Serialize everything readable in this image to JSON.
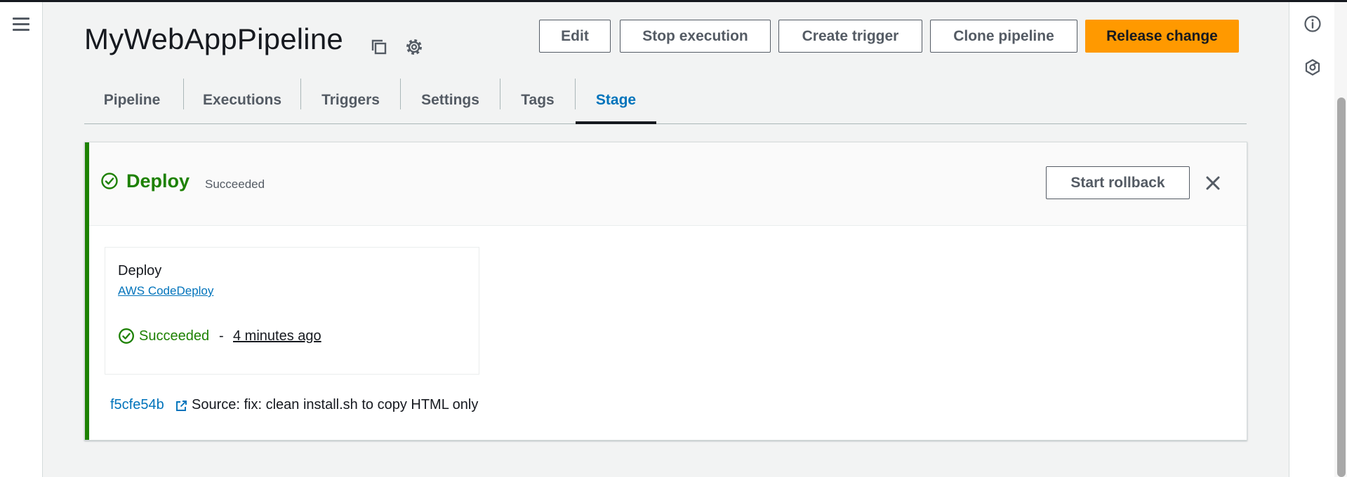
{
  "header": {
    "title": "MyWebAppPipeline",
    "buttons": {
      "edit": "Edit",
      "stop_execution": "Stop execution",
      "create_trigger": "Create trigger",
      "clone_pipeline": "Clone pipeline",
      "release_change": "Release change"
    }
  },
  "tabs": [
    {
      "label": "Pipeline",
      "active": false
    },
    {
      "label": "Executions",
      "active": false
    },
    {
      "label": "Triggers",
      "active": false
    },
    {
      "label": "Settings",
      "active": false
    },
    {
      "label": "Tags",
      "active": false
    },
    {
      "label": "Stage",
      "active": true
    }
  ],
  "stage": {
    "name": "Deploy",
    "status": "Succeeded",
    "rollback_label": "Start rollback",
    "action": {
      "name": "Deploy",
      "provider": "AWS CodeDeploy",
      "status": "Succeeded",
      "separator": "-",
      "time": "4 minutes ago"
    },
    "source": {
      "commit_id": "f5cfe54b",
      "message": "Source: fix: clean install.sh to copy HTML only"
    }
  },
  "icons": {
    "menu": "hamburger-menu-icon",
    "copy": "copy-icon",
    "settings": "gear-icon",
    "info": "info-icon",
    "feedback": "hexagon-icon",
    "close": "close-icon",
    "success": "check-circle-icon",
    "external": "external-link-icon"
  },
  "colors": {
    "accent_orange": "#ff9900",
    "link_blue": "#0073bb",
    "success_green": "#1d8102",
    "text_dark": "#16191f",
    "text_gray": "#545b64"
  }
}
